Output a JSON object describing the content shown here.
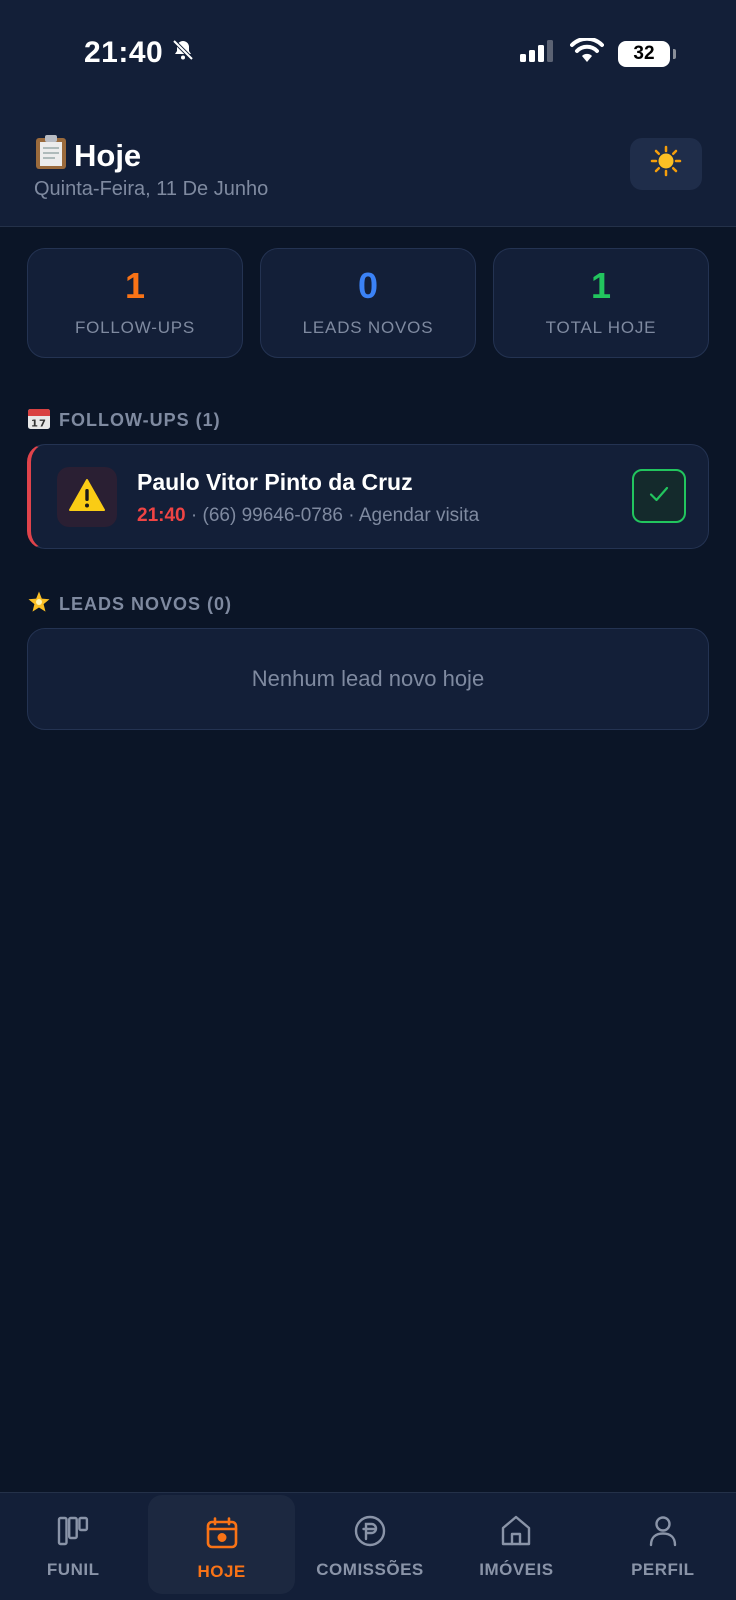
{
  "status_bar": {
    "time": "21:40",
    "battery": "32"
  },
  "header": {
    "title": "Hoje",
    "subtitle": "Quinta-Feira, 11 De Junho",
    "theme_icon": "sun-icon"
  },
  "stats": [
    {
      "value": "1",
      "label": "FOLLOW-UPS",
      "color": "#f97316"
    },
    {
      "value": "0",
      "label": "LEADS NOVOS",
      "color": "#3b82f6"
    },
    {
      "value": "1",
      "label": "TOTAL HOJE",
      "color": "#22c55e"
    }
  ],
  "followups_section": {
    "title": "FOLLOW-UPS (1)",
    "items": [
      {
        "name": "Paulo Vitor Pinto da Cruz",
        "time": "21:40",
        "phone": "(66) 99646-0786",
        "action": "Agendar visita",
        "separator": "·"
      }
    ]
  },
  "leads_section": {
    "title": "LEADS NOVOS (0)",
    "empty_text": "Nenhum lead novo hoje"
  },
  "bottom_nav": {
    "items": [
      {
        "label": "FUNIL",
        "icon": "funnel-board-icon"
      },
      {
        "label": "HOJE",
        "icon": "calendar-icon",
        "active": true
      },
      {
        "label": "COMISSÕES",
        "icon": "coin-icon"
      },
      {
        "label": "IMÓVEIS",
        "icon": "home-icon"
      },
      {
        "label": "PERFIL",
        "icon": "user-icon"
      }
    ],
    "active_color": "#f97316"
  }
}
